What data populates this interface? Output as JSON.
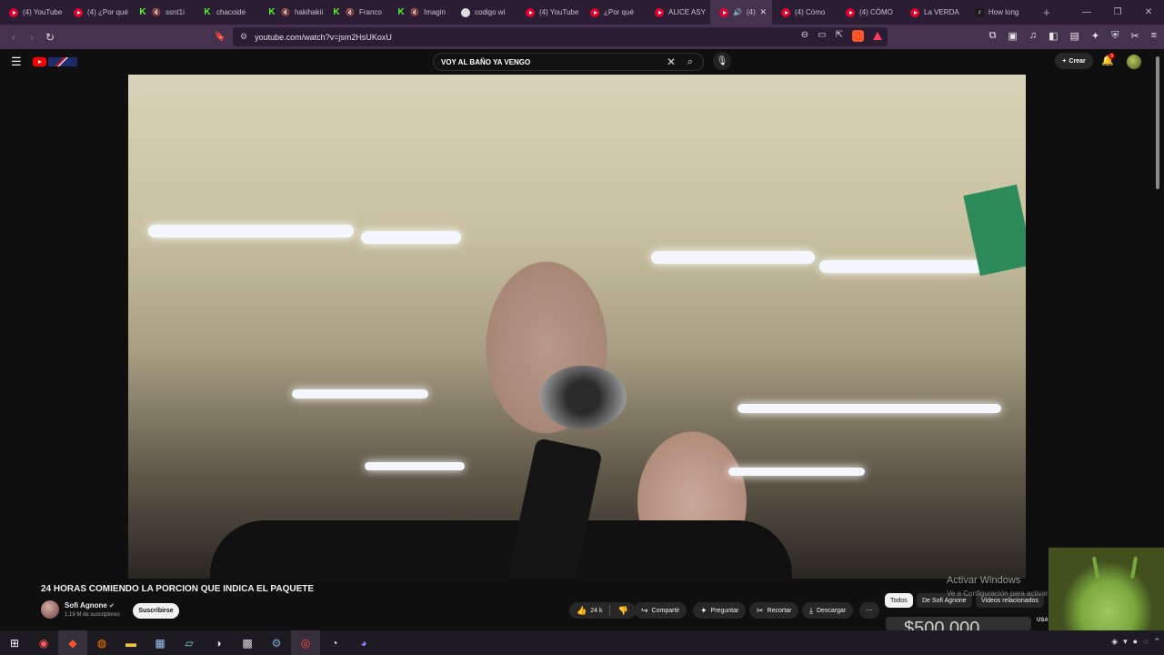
{
  "browser": {
    "tabs": [
      {
        "title": "(4) YouTube",
        "icon": "youtube-icon"
      },
      {
        "title": "(4) ¿Por qué",
        "icon": "youtube-icon"
      },
      {
        "title": "ssnt1i",
        "icon": "kick-icon",
        "muted": true
      },
      {
        "title": "chacoide",
        "icon": "kick-icon"
      },
      {
        "title": "hakihakii",
        "icon": "kick-icon",
        "muted": true
      },
      {
        "title": "Franco",
        "icon": "kick-icon",
        "muted": true
      },
      {
        "title": "Imagin",
        "icon": "kick-icon",
        "muted": true
      },
      {
        "title": "codigo wi",
        "icon": "google-icon"
      },
      {
        "title": "(4) YouTube",
        "icon": "youtube-icon"
      },
      {
        "title": "¿Por qué",
        "icon": "youtube-icon"
      },
      {
        "title": "ALICE ASY",
        "icon": "youtube-icon"
      },
      {
        "title": "(4)",
        "icon": "youtube-icon",
        "active": true,
        "playing": true
      },
      {
        "title": "(4) Cómo",
        "icon": "youtube-icon"
      },
      {
        "title": "(4) CÓMO",
        "icon": "youtube-icon"
      },
      {
        "title": "La VERDA",
        "icon": "youtube-icon"
      },
      {
        "title": "How long",
        "icon": "tiktok-icon"
      }
    ],
    "url": "youtube.com/watch?v=jsm2HsUKoxU"
  },
  "youtube": {
    "search_query": "VOY AL BAÑO YA VENGO",
    "create_label": "Crear",
    "notification_count": "9",
    "video": {
      "title": "24 HORAS COMIENDO LA PORCION QUE INDICA EL PAQUETE",
      "channel_name": "Sofi Agnone",
      "subscribers": "1,19 M de suscriptores",
      "subscribe_label": "Suscribirse",
      "likes": "24 k",
      "share_label": "Compartir",
      "ask_label": "Preguntar",
      "clip_label": "Recortar",
      "download_label": "Descargar"
    },
    "chips": [
      "Todos",
      "De Sofi Agnone",
      "Videos relacionados"
    ],
    "thumbnail_text": "$500.000",
    "thumbnail_side": "USA CAS"
  },
  "windows_watermark": {
    "line1": "Activar Windows",
    "line2": "Ve a Configuración para activar Windows."
  }
}
